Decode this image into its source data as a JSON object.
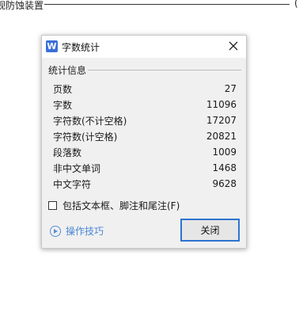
{
  "background": {
    "doc_text": "观防蚀装置",
    "end_mark": "("
  },
  "dialog": {
    "title": "字数统计",
    "app_icon_letter": "W",
    "group_title": "统计信息",
    "stats": [
      {
        "label": "页数",
        "value": "27"
      },
      {
        "label": "字数",
        "value": "11096"
      },
      {
        "label": "字符数(不计空格)",
        "value": "17207"
      },
      {
        "label": "字符数(计空格)",
        "value": "20821"
      },
      {
        "label": "段落数",
        "value": "1009"
      },
      {
        "label": "非中文单词",
        "value": "1468"
      },
      {
        "label": "中文字符",
        "value": "9628"
      }
    ],
    "checkbox_label": "包括文本框、脚注和尾注(F)",
    "checkbox_checked": false,
    "help_label": "操作技巧",
    "close_button_label": "关闭"
  },
  "colors": {
    "accent": "#2e73d1",
    "app_icon": "#3a6fd8",
    "link": "#4a86d4",
    "dialog_bg": "#f0f0f0"
  }
}
